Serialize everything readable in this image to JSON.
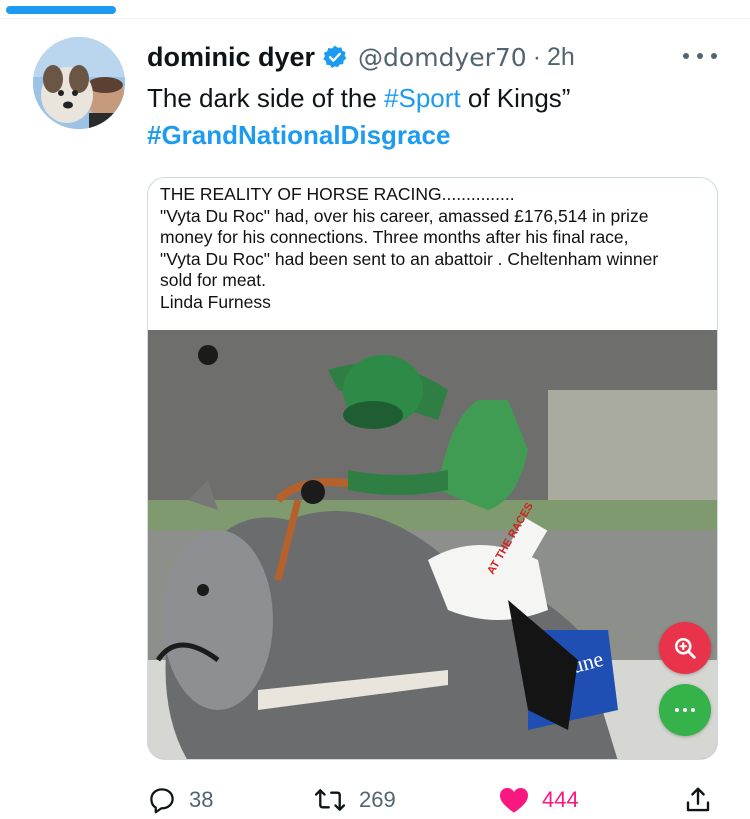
{
  "tweet": {
    "display_name": "dominic dyer",
    "handle": "@domdyer70",
    "separator": "·",
    "time": "2h",
    "text_prefix": "The dark side of the ",
    "hashtag_sport": "#Sport",
    "text_suffix": " of Kings”",
    "hashtag_main": "#GrandNationalDisgrace"
  },
  "media": {
    "text_lines": [
      "THE REALITY OF HORSE RACING...............",
      "\"Vyta Du Roc\" had, over his career, amassed £176,514 in prize",
      "money for his connections. Three months after his final race,",
      "\"Vyta Du Roc\" had been sent to an abattoir . Cheltenham winner",
      "sold for meat.",
      "Linda Furness"
    ],
    "photo_subject": "grey racehorse with jockey in green silks",
    "saddle_cloth_text": "tune",
    "sleeve_text": "AT THE RACES"
  },
  "overlay_buttons": {
    "lens_icon": "zoom-lens-icon",
    "more_icon": "ellipsis-icon"
  },
  "actions": {
    "replies": "38",
    "retweets": "269",
    "likes": "444"
  },
  "colors": {
    "accent": "#1d9bf0",
    "like": "#f91880",
    "muted": "#536471",
    "lens_button": "#e8334a",
    "more_button": "#35b24a"
  }
}
